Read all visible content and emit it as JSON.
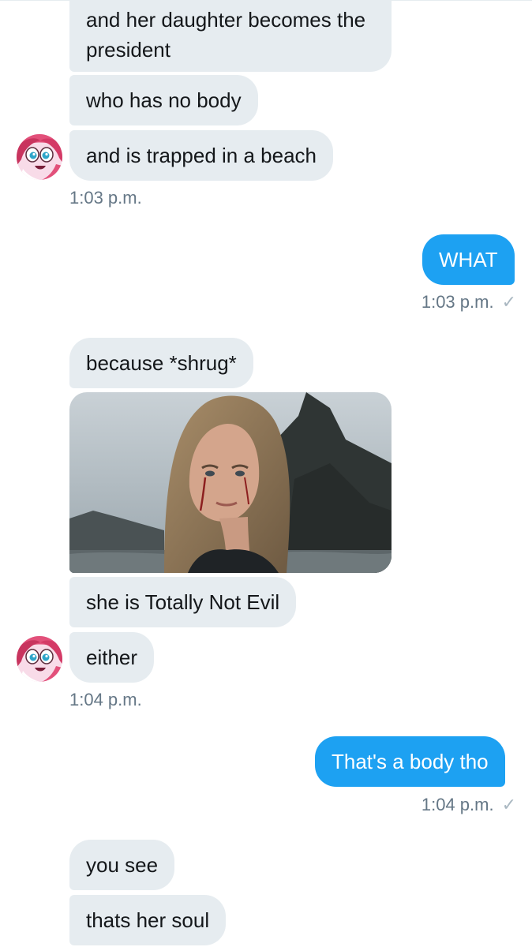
{
  "messages": {
    "m1": "and her daughter becomes the president",
    "m2": "who has no body",
    "m3": "and is trapped in a beach",
    "t1": "1:03 p.m.",
    "m4": "WHAT",
    "t2": "1:03 p.m.",
    "m5": "because *shrug*",
    "m6": "she is Totally Not Evil",
    "m7": "either",
    "t3": "1:04 p.m.",
    "m8": "That's a body tho",
    "t4": "1:04 p.m.",
    "m9": "you see",
    "m10": "thats her soul"
  },
  "icons": {
    "read_check": "✓"
  },
  "colors": {
    "incoming_bubble": "#e6ecf0",
    "outgoing_bubble": "#1da1f2",
    "timestamp": "#657786"
  }
}
